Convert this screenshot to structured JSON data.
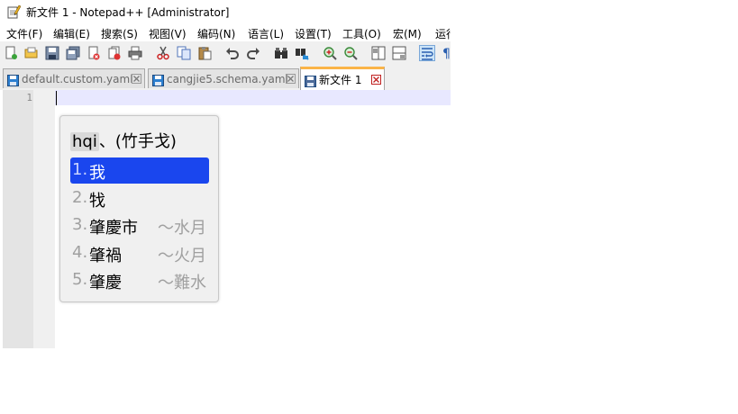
{
  "window": {
    "title": "新文件 1 - Notepad++ [Administrator]"
  },
  "menu": [
    {
      "label": "文件(F)"
    },
    {
      "label": "编辑(E)"
    },
    {
      "label": "搜索(S)"
    },
    {
      "label": "视图(V)"
    },
    {
      "label": "编码(N)"
    },
    {
      "label": "语言(L)"
    },
    {
      "label": "设置(T)"
    },
    {
      "label": "工具(O)"
    },
    {
      "label": "宏(M)"
    },
    {
      "label": "运行"
    }
  ],
  "toolbar": [
    {
      "icon": "new-file-icon"
    },
    {
      "icon": "open-file-icon"
    },
    {
      "icon": "save-icon"
    },
    {
      "icon": "save-all-icon"
    },
    {
      "icon": "close-icon"
    },
    {
      "icon": "close-all-icon"
    },
    {
      "icon": "print-icon"
    },
    {
      "icon": "cut-icon"
    },
    {
      "icon": "copy-icon"
    },
    {
      "icon": "paste-icon"
    },
    {
      "icon": "undo-icon"
    },
    {
      "icon": "redo-icon"
    },
    {
      "icon": "find-icon"
    },
    {
      "icon": "replace-icon"
    },
    {
      "icon": "zoom-in-icon"
    },
    {
      "icon": "zoom-out-icon"
    },
    {
      "icon": "sync-vertical-icon"
    },
    {
      "icon": "sync-horizontal-icon"
    },
    {
      "icon": "word-wrap-icon",
      "active": true
    },
    {
      "icon": "show-all-chars-icon"
    }
  ],
  "tabs": [
    {
      "label": "default.custom.yaml",
      "active": false
    },
    {
      "label": "cangjie5.schema.yaml",
      "active": false
    },
    {
      "label": "新文件 1",
      "active": true
    }
  ],
  "editor": {
    "line_numbers": [
      "1"
    ]
  },
  "ime": {
    "code": "hqi",
    "preedit_rest": "、(竹手戈)",
    "candidates": [
      {
        "index": "1.",
        "text": "我",
        "comment": ""
      },
      {
        "index": "2.",
        "text": "牫",
        "comment": ""
      },
      {
        "index": "3.",
        "text": "肇慶市",
        "comment": "～水月"
      },
      {
        "index": "4.",
        "text": "肇禍",
        "comment": "～火月"
      },
      {
        "index": "5.",
        "text": "肇慶",
        "comment": "～難水"
      }
    ],
    "highlighted_index": 0
  },
  "colors": {
    "ime_highlight": "#1a46ee",
    "current_line": "#e8e8ff",
    "active_tab_accent": "#fab448"
  }
}
